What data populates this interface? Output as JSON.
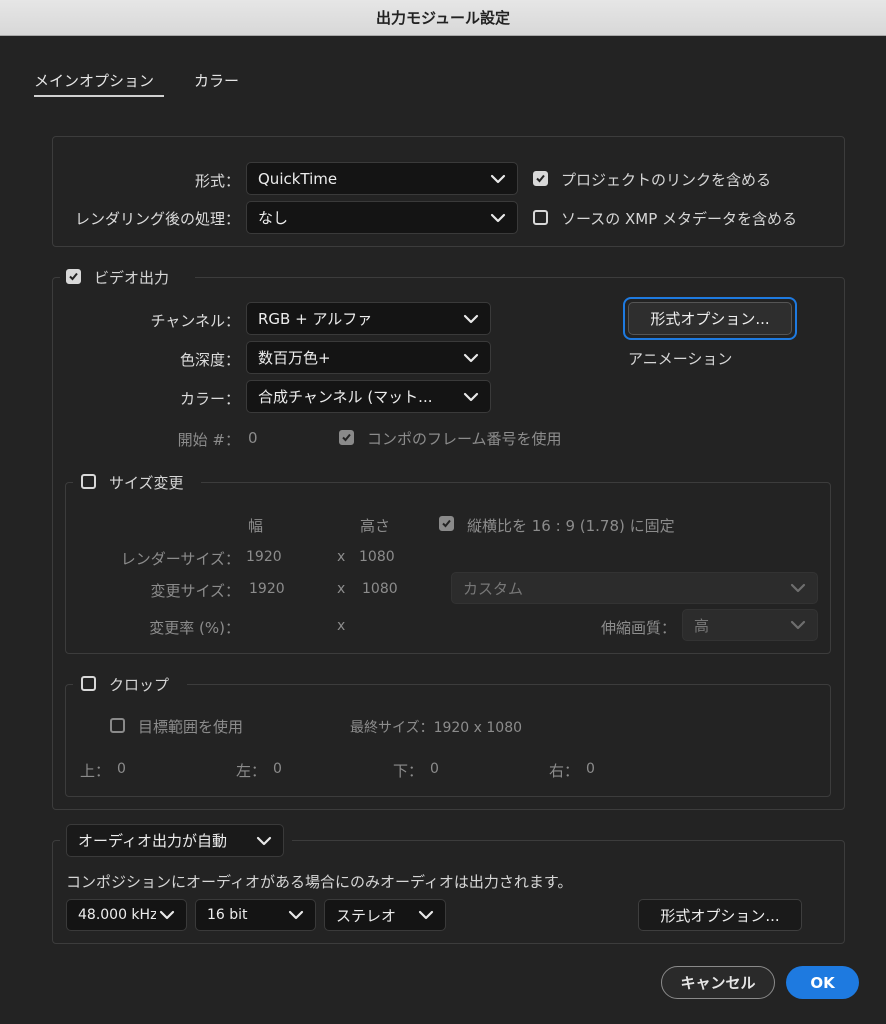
{
  "window": {
    "title": "出力モジュール設定"
  },
  "tabs": {
    "main": "メインオプション",
    "color": "カラー"
  },
  "top": {
    "format_label": "形式：",
    "format_value": "QuickTime",
    "post_render_label": "レンダリング後の処理：",
    "post_render_value": "なし",
    "include_project_link": "プロジェクトのリンクを含める",
    "include_xmp": "ソースの XMP メタデータを含める"
  },
  "video": {
    "section_label": "ビデオ出力",
    "channel_label": "チャンネル：",
    "channel_value": "RGB + アルファ",
    "depth_label": "色深度：",
    "depth_value": "数百万色+",
    "color_label": "カラー：",
    "color_value": "合成チャンネル (マット...",
    "start_label": "開始 #：",
    "start_value": "0",
    "use_comp_frame": "コンポのフレーム番号を使用",
    "format_options_button": "形式オプション...",
    "codec_name": "アニメーション"
  },
  "resize": {
    "section_label": "サイズ変更",
    "col_width": "幅",
    "col_height": "高さ",
    "lock_aspect": "縦横比を 16 : 9 (1.78) に固定",
    "render_size_label": "レンダーサイズ：",
    "render_w": "1920",
    "render_x": "x",
    "render_h": "1080",
    "resize_to_label": "変更サイズ：",
    "resize_w": "1920",
    "resize_x": "x",
    "resize_h": "1080",
    "preset_value": "カスタム",
    "percent_label": "変更率 (%)：",
    "percent_x": "x",
    "quality_label": "伸縮画質：",
    "quality_value": "高"
  },
  "crop": {
    "section_label": "クロップ",
    "use_roi": "目標範囲を使用",
    "final_size": "最終サイズ：1920 x 1080",
    "top_label": "上：",
    "top_value": "0",
    "left_label": "左：",
    "left_value": "0",
    "bottom_label": "下：",
    "bottom_value": "0",
    "right_label": "右：",
    "right_value": "0"
  },
  "audio": {
    "mode_value": "オーディオ出力が自動",
    "description": "コンポジションにオーディオがある場合にのみオーディオは出力されます。",
    "sample_rate": "48.000 kHz",
    "bit_depth": "16 bit",
    "channels": "ステレオ",
    "format_options_button": "形式オプション..."
  },
  "footer": {
    "cancel": "キャンセル",
    "ok": "OK"
  },
  "colors": {
    "accent": "#1e7ae0",
    "bg": "#232323",
    "field": "#141414"
  },
  "icons": [
    "chevron-down-icon",
    "checkmark-icon"
  ]
}
